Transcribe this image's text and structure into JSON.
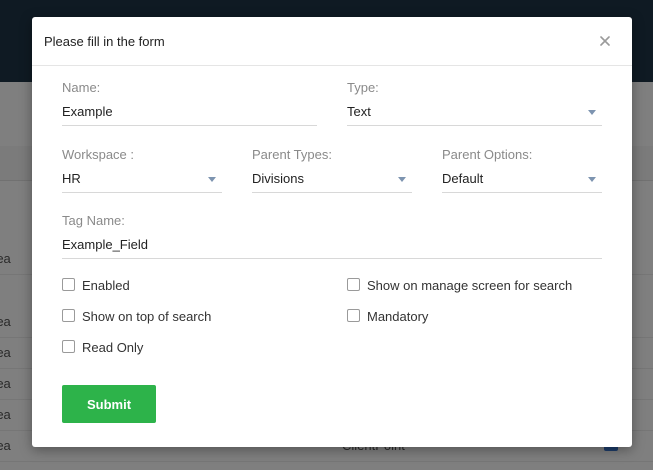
{
  "background": {
    "rows": [
      {
        "a": "rea",
        "dash": "",
        "client": ""
      },
      {
        "a": "rea",
        "dash": "",
        "client": ""
      },
      {
        "a": "rea",
        "dash": "",
        "client": ""
      },
      {
        "a": "rea",
        "dash": "",
        "client": ""
      },
      {
        "a": "rea",
        "dash": "",
        "client": ""
      },
      {
        "a": "rea",
        "dash": "---",
        "client": "ClientPoint"
      }
    ]
  },
  "modal": {
    "title": "Please fill in the form",
    "close_glyph": "×",
    "fields": {
      "name": {
        "label": "Name:",
        "value": "Example"
      },
      "type": {
        "label": "Type:",
        "value": "Text"
      },
      "workspace": {
        "label": "Workspace :",
        "value": "HR"
      },
      "parent_types": {
        "label": "Parent Types:",
        "value": "Divisions"
      },
      "parent_options": {
        "label": "Parent Options:",
        "value": "Default"
      },
      "tag_name": {
        "label": "Tag Name:",
        "value": "Example_Field"
      }
    },
    "checkboxes": {
      "enabled": {
        "label": "Enabled",
        "checked": false
      },
      "show_manage": {
        "label": "Show on manage screen for search",
        "checked": false
      },
      "show_top": {
        "label": "Show on top of search",
        "checked": false
      },
      "mandatory": {
        "label": "Mandatory",
        "checked": false
      },
      "read_only": {
        "label": "Read Only",
        "checked": false
      }
    },
    "submit_label": "Submit"
  },
  "colors": {
    "topbar": "#1e3446",
    "submit": "#2db34a",
    "caret": "#7d94b0"
  }
}
